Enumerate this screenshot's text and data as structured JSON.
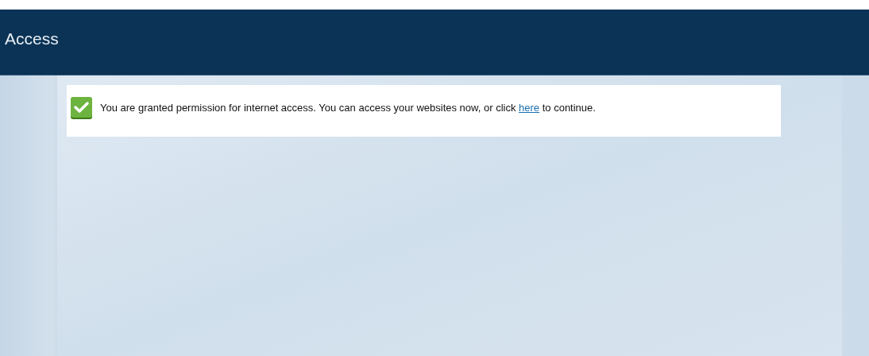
{
  "header": {
    "title": "Access"
  },
  "message": {
    "text_before": "You are granted permission for internet access. You can access your websites now, or click",
    "link": "here",
    "text_after": "to continue."
  }
}
